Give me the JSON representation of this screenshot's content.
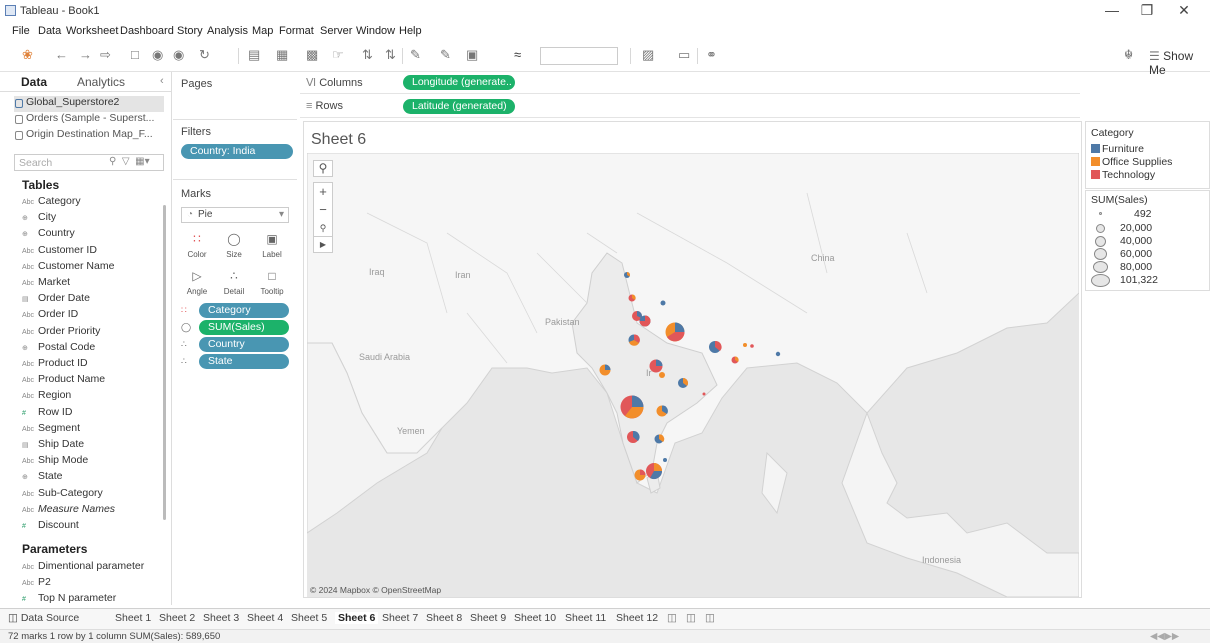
{
  "window": {
    "title": "Tableau - Book1"
  },
  "menu": [
    "File",
    "Data",
    "Worksheet",
    "Dashboard",
    "Story",
    "Analysis",
    "Map",
    "Format",
    "Server",
    "Window",
    "Help"
  ],
  "toolbar": {
    "show_me": "Show Me"
  },
  "data_pane": {
    "tab_data": "Data",
    "tab_analytics": "Analytics",
    "sources": [
      "Global_Superstore2",
      "Orders (Sample - Superst...",
      "Origin Destination Map_F..."
    ],
    "search_placeholder": "Search",
    "tables_heading": "Tables",
    "fields": [
      {
        "type": "Abc",
        "name": "Category"
      },
      {
        "type": "⊕",
        "name": "City"
      },
      {
        "type": "⊕",
        "name": "Country"
      },
      {
        "type": "Abc",
        "name": "Customer ID"
      },
      {
        "type": "Abc",
        "name": "Customer Name"
      },
      {
        "type": "Abc",
        "name": "Market"
      },
      {
        "type": "▤",
        "name": "Order Date"
      },
      {
        "type": "Abc",
        "name": "Order ID"
      },
      {
        "type": "Abc",
        "name": "Order Priority"
      },
      {
        "type": "⊕",
        "name": "Postal Code"
      },
      {
        "type": "Abc",
        "name": "Product ID"
      },
      {
        "type": "Abc",
        "name": "Product Name"
      },
      {
        "type": "Abc",
        "name": "Region"
      },
      {
        "type": "#",
        "name": "Row ID"
      },
      {
        "type": "Abc",
        "name": "Segment"
      },
      {
        "type": "▤",
        "name": "Ship Date"
      },
      {
        "type": "Abc",
        "name": "Ship Mode"
      },
      {
        "type": "⊕",
        "name": "State"
      },
      {
        "type": "Abc",
        "name": "Sub-Category"
      },
      {
        "type": "Abc",
        "name": "Measure Names"
      },
      {
        "type": "#",
        "name": "Discount"
      }
    ],
    "parameters_heading": "Parameters",
    "parameters": [
      {
        "type": "Abc",
        "name": "Dimentional parameter"
      },
      {
        "type": "Abc",
        "name": "P2"
      },
      {
        "type": "#",
        "name": "Top N parameter"
      }
    ]
  },
  "pages": {
    "label": "Pages"
  },
  "filters": {
    "label": "Filters",
    "pill": "Country: India"
  },
  "marks": {
    "label": "Marks",
    "type": "Pie",
    "buttons": [
      "Color",
      "Size",
      "Label",
      "Angle",
      "Detail",
      "Tooltip"
    ],
    "fields": [
      {
        "icon": "color",
        "name": "Category"
      },
      {
        "icon": "size",
        "name": "SUM(Sales)"
      },
      {
        "icon": "detail",
        "name": "Country"
      },
      {
        "icon": "detail",
        "name": "State"
      }
    ]
  },
  "shelves": {
    "columns_label": "Columns",
    "columns_pill": "Longitude (generate..",
    "rows_label": "Rows",
    "rows_pill": "Latitude (generated)"
  },
  "view": {
    "title": "Sheet 6",
    "attribution": "© 2024 Mapbox © OpenStreetMap",
    "map_labels": [
      "China",
      "Iraq",
      "Iran",
      "Pakistan",
      "Saudi Arabia",
      "Yemen",
      "Indonesia",
      "Ir"
    ]
  },
  "colors": {
    "furniture": "#4e79a7",
    "office_supplies": "#f28e2b",
    "technology": "#e15759",
    "pill_blue": "#4996b2",
    "pill_green": "#1cb26a"
  },
  "legend": {
    "category_title": "Category",
    "categories": [
      "Furniture",
      "Office Supplies",
      "Technology"
    ],
    "size_title": "SUM(Sales)",
    "sizes": [
      "492",
      "20,000",
      "40,000",
      "60,000",
      "80,000",
      "101,322"
    ]
  },
  "sheets": {
    "data_source": "Data Source",
    "tabs": [
      "Sheet 1",
      "Sheet 2",
      "Sheet 3",
      "Sheet 4",
      "Sheet 5",
      "Sheet 6",
      "Sheet 7",
      "Sheet 8",
      "Sheet 9",
      "Sheet 10",
      "Sheet 11",
      "Sheet 12"
    ],
    "active": "Sheet 6"
  },
  "status": {
    "text": "72 marks   1 row by 1 column   SUM(Sales): 589,650"
  }
}
